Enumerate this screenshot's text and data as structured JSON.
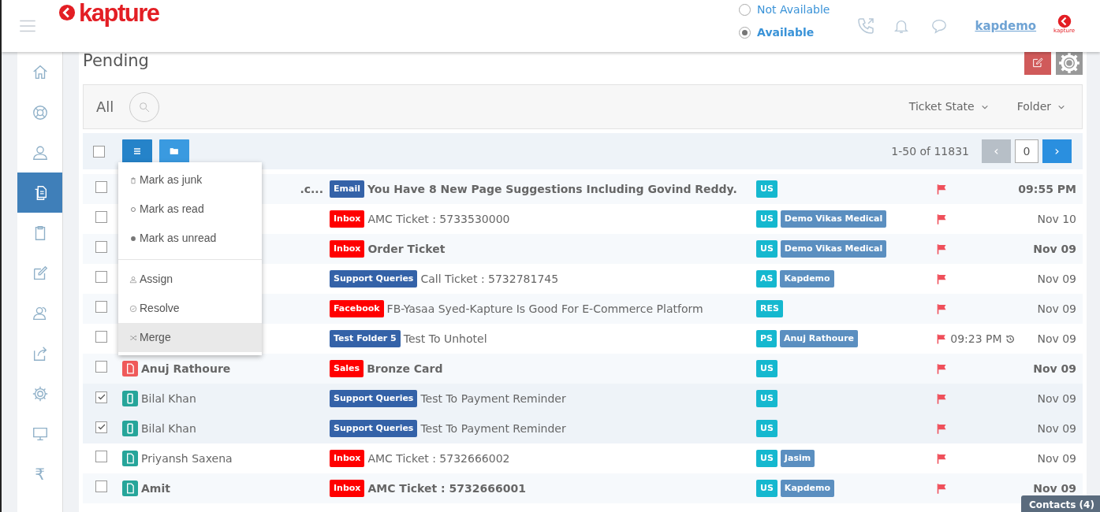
{
  "header": {
    "logo": "kapture",
    "availability": [
      {
        "label": "Not Available",
        "selected": false
      },
      {
        "label": "Available",
        "selected": true
      }
    ],
    "user": "kapdemo",
    "brand_mark": "kapture"
  },
  "sidebar": {
    "items": [
      {
        "kind": "home",
        "selected": false
      },
      {
        "kind": "lifebuoy",
        "selected": false
      },
      {
        "kind": "user",
        "selected": false
      },
      {
        "kind": "documents",
        "selected": true
      },
      {
        "kind": "clipboard",
        "selected": false
      },
      {
        "kind": "edit",
        "selected": false
      },
      {
        "kind": "users",
        "selected": false
      },
      {
        "kind": "share",
        "selected": false
      },
      {
        "kind": "gear",
        "selected": false
      },
      {
        "kind": "monitor",
        "selected": false
      },
      {
        "kind": "text",
        "label": "₹",
        "selected": false
      }
    ]
  },
  "page": {
    "title": "Pending"
  },
  "filter_bar": {
    "view": "All",
    "filters": [
      "Ticket State",
      "Folder"
    ]
  },
  "toolbar": {
    "select_all_checked": false,
    "range": "1-50 of 11831",
    "page": "0",
    "prev": "‹",
    "next": "›"
  },
  "action_menu": {
    "groups": [
      [
        {
          "kind": "trash",
          "label": "Mark as junk",
          "selected": false
        },
        {
          "kind": "circle",
          "label": "Mark as read",
          "selected": false
        },
        {
          "kind": "dot",
          "label": "Mark as unread",
          "selected": false
        }
      ],
      [
        {
          "kind": "user",
          "label": "Assign",
          "selected": false
        },
        {
          "kind": "check",
          "label": "Resolve",
          "selected": false
        },
        {
          "kind": "shuffle",
          "label": "Merge",
          "selected": true
        }
      ]
    ]
  },
  "tickets": [
    {
      "checked": false,
      "sender": ".c...",
      "covered": true,
      "unread": true,
      "tag": {
        "label": "Email",
        "color": "#3462a8"
      },
      "subject": "You Have 8 New Page Suggestions Including Govind Reddy.",
      "status": "US",
      "date": "09:55 PM"
    },
    {
      "checked": false,
      "unread": false,
      "tag": {
        "label": "Inbox",
        "color": "#ff0000"
      },
      "subject": "AMC Ticket : 5733530000",
      "status": "US",
      "assignee": "Demo Vikas Medical",
      "date": "Nov 10"
    },
    {
      "checked": false,
      "unread": true,
      "tag": {
        "label": "Inbox",
        "color": "#ff0000"
      },
      "subject": "Order Ticket",
      "status": "US",
      "assignee": "Demo Vikas Medical",
      "date": "Nov 09"
    },
    {
      "checked": false,
      "unread": false,
      "tag": {
        "label": "Support Queries",
        "color": "#3462a8"
      },
      "subject": "Call Ticket : 5732781745",
      "status": "AS",
      "assignee": "Kapdemo",
      "date": "Nov 09"
    },
    {
      "checked": false,
      "unread": false,
      "tag": {
        "label": "Facebook",
        "color": "#ff0000"
      },
      "subject": "FB-Yasaa Syed-Kapture Is Good For E-Commerce Platform",
      "status": "RES",
      "date": "Nov 09"
    },
    {
      "checked": false,
      "unread": false,
      "tag": {
        "label": "Test Folder 5",
        "color": "#3462a8"
      },
      "subject": "Test To Unhotel",
      "status": "PS",
      "assignee": "Anuj Rathoure",
      "time": "09:23 PM",
      "date": "Nov 09"
    },
    {
      "checked": false,
      "sender": "Anuj Rathoure",
      "source": {
        "kind": "doc",
        "color": "#ef5a5a"
      },
      "unread": true,
      "tag": {
        "label": "Sales",
        "color": "#ff0000"
      },
      "subject": "Bronze Card",
      "status": "US",
      "date": "Nov 09"
    },
    {
      "checked": true,
      "sender": "Bilal Khan",
      "source": {
        "kind": "phone",
        "color": "#26a59a"
      },
      "unread": false,
      "tag": {
        "label": "Support Queries",
        "color": "#3462a8"
      },
      "subject": "Test To Payment Reminder",
      "status": "US",
      "date": "Nov 09"
    },
    {
      "checked": true,
      "sender": "Bilal Khan",
      "source": {
        "kind": "phone",
        "color": "#26a59a"
      },
      "unread": false,
      "tag": {
        "label": "Support Queries",
        "color": "#3462a8"
      },
      "subject": "Test To Payment Reminder",
      "status": "US",
      "date": "Nov 09"
    },
    {
      "checked": false,
      "sender": "Priyansh Saxena",
      "source": {
        "kind": "doc",
        "color": "#26a59a"
      },
      "unread": false,
      "tag": {
        "label": "Inbox",
        "color": "#ff0000"
      },
      "subject": "AMC Ticket : 5732666002",
      "status": "US",
      "assignee": "Jasim",
      "date": "Nov 09"
    },
    {
      "checked": false,
      "sender": "Amit",
      "source": {
        "kind": "doc",
        "color": "#26a59a"
      },
      "unread": true,
      "tag": {
        "label": "Inbox",
        "color": "#ff0000"
      },
      "subject": "AMC Ticket : 5732666001",
      "status": "US",
      "assignee": "Kapdemo",
      "date": "Nov 09"
    }
  ],
  "contacts_tab": "Contacts (4)"
}
